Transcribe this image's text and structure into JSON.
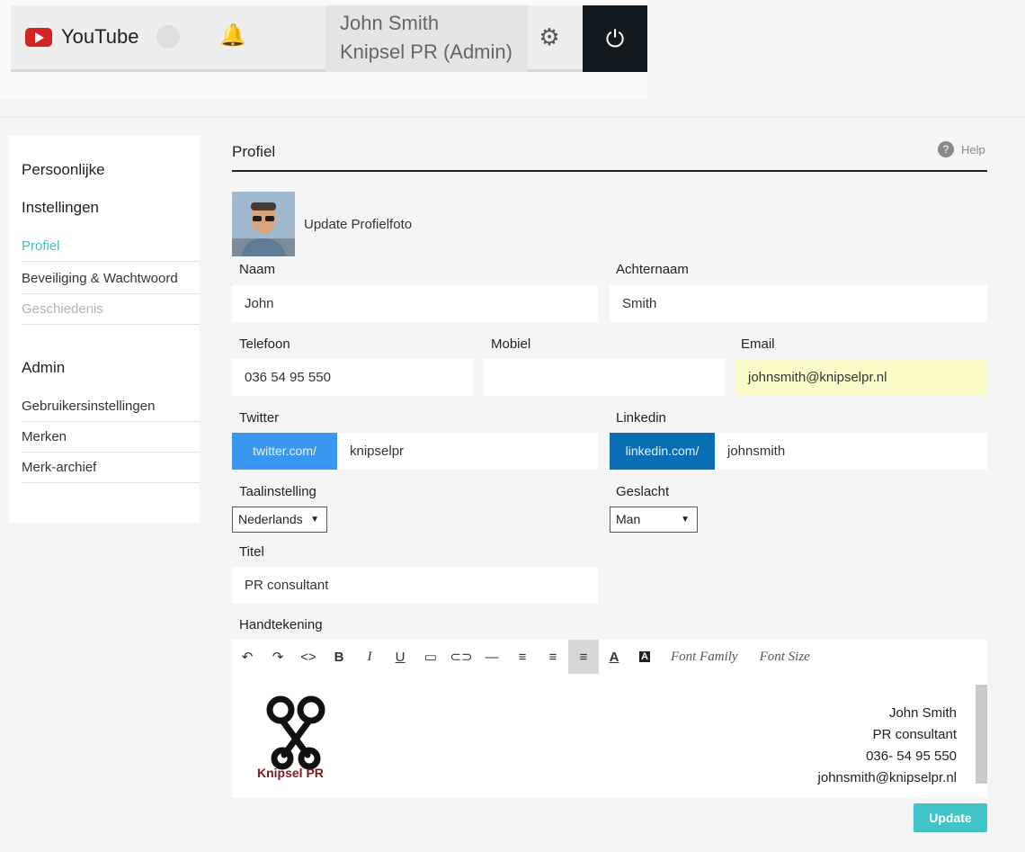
{
  "header": {
    "brand": "YouTube",
    "user_name": "John Smith",
    "user_org": "Knipsel PR (Admin)"
  },
  "sidebar": {
    "heading_1": "Persoonlijke",
    "heading_2": "Instellingen",
    "items": [
      "Profiel",
      "Beveiliging & Wachtwoord",
      "Geschiedenis"
    ],
    "admin_heading": "Admin",
    "admin_items": [
      "Gebruikersinstellingen",
      "Merken",
      "Merk-archief"
    ]
  },
  "profile": {
    "title": "Profiel",
    "help": "Help",
    "photo_label": "Update Profielfoto",
    "fields": {
      "naam_label": "Naam",
      "naam_value": "John",
      "achternaam_label": "Achternaam",
      "achternaam_value": "Smith",
      "telefoon_label": "Telefoon",
      "telefoon_value": "036 54 95 550",
      "mobiel_label": "Mobiel",
      "mobiel_value": "",
      "email_label": "Email",
      "email_value": "johnsmith@knipselpr.nl",
      "twitter_label": "Twitter",
      "twitter_prefix": "twitter.com/",
      "twitter_value": "knipselpr",
      "linkedin_label": "Linkedin",
      "linkedin_prefix": "linkedin.com/",
      "linkedin_value": "johnsmith",
      "taal_label": "Taalinstelling",
      "taal_value": "Nederlands",
      "geslacht_label": "Geslacht",
      "geslacht_value": "Man",
      "titel_label": "Titel",
      "titel_value": "PR consultant",
      "handtekening_label": "Handtekening"
    },
    "editor_toolbar": {
      "font_family": "Font Family",
      "font_size": "Font Size"
    },
    "signature": {
      "logo_text": "Knipsel PR",
      "line1": "John Smith",
      "line2": "PR consultant",
      "line3": "036- 54 95 550",
      "line4": "johnsmith@knipselpr.nl"
    },
    "update_button": "Update"
  },
  "colors": {
    "accent": "#40c4c8",
    "twitter": "#3a97f1",
    "linkedin": "#0a6eb4",
    "brand_red": "#d32323",
    "email_highlight": "#fbfbc9"
  }
}
